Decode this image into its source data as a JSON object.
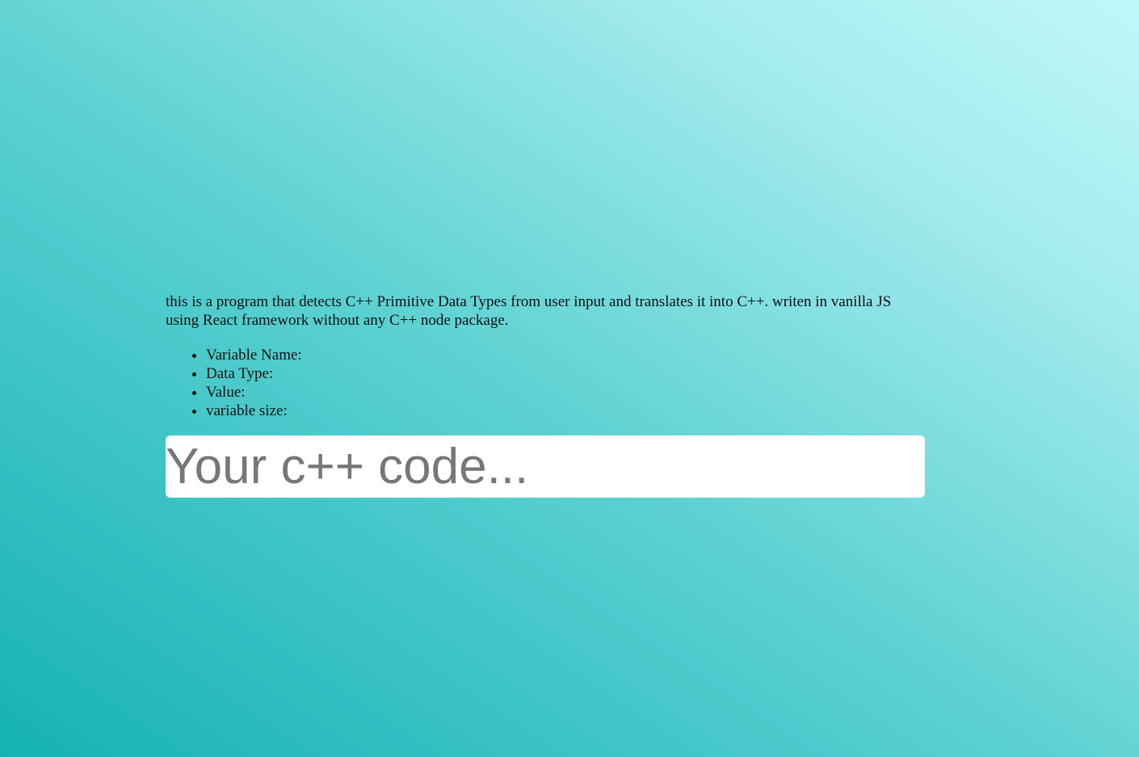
{
  "intro": {
    "description": "this is a program that detects C++ Primitive Data Types from user input and translates it into C++. writen in vanilla JS using React framework without any C++ node package."
  },
  "fields": [
    {
      "label": "Variable Name:"
    },
    {
      "label": "Data Type:"
    },
    {
      "label": "Value:"
    },
    {
      "label": "variable size:"
    }
  ],
  "code_input": {
    "value": "",
    "placeholder": "Your c++ code..."
  },
  "colors": {
    "background_start": "#16b2b3",
    "background_end": "#c0f8f8",
    "input_background": "#ffffff",
    "placeholder_text": "#777777"
  }
}
